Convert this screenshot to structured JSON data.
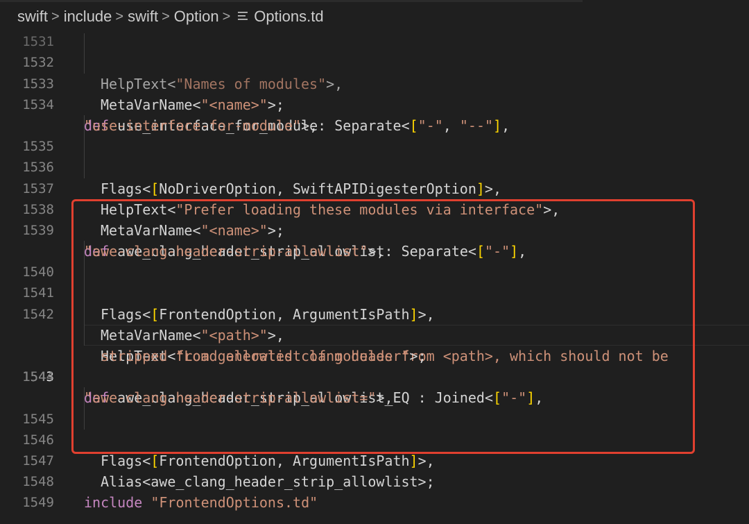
{
  "breadcrumb": {
    "items": [
      "swift",
      "include",
      "swift",
      "Option"
    ],
    "file": "Options.td",
    "separator": ">"
  },
  "code": {
    "lines": [
      {
        "num": "1531",
        "text": "HelpText<\"Names of modules\">,"
      },
      {
        "num": "1532",
        "text": "MetaVarName<\"<name>\">;"
      },
      {
        "num": "1533",
        "text": ""
      },
      {
        "num": "1534",
        "text": "def use_interface_for_module: Separate<[\"-\", \"--\"],"
      },
      {
        "num": "",
        "text": "\"use-interface-for-module\">,"
      },
      {
        "num": "1535",
        "text": "Flags<[NoDriverOption, SwiftAPIDigesterOption]>,"
      },
      {
        "num": "1536",
        "text": "HelpText<\"Prefer loading these modules via interface\">,"
      },
      {
        "num": "1537",
        "text": "MetaVarName<\"<name>\">;"
      },
      {
        "num": "1538",
        "text": ""
      },
      {
        "num": "1539",
        "text": "def awe_clang_header_strip_allowlist: Separate<[\"-\"],"
      },
      {
        "num": "",
        "text": "\"awe-clang-header-strip-allowlist\">,"
      },
      {
        "num": "1540",
        "text": "Flags<[FrontendOption, ArgumentIsPath]>,"
      },
      {
        "num": "1541",
        "text": "MetaVarName<\"<path>\">,"
      },
      {
        "num": "1542",
        "text": "HelpText<\"Load allowlist of modules from <path>, which should not be"
      },
      {
        "num": "",
        "text": "stripped from generated clang header\">;"
      },
      {
        "num": "1543",
        "text": ""
      },
      {
        "num": "1544",
        "text": "def awe_clang_header_strip_allowlist_EQ : Joined<[\"-\"],"
      },
      {
        "num": "",
        "text": "\"awe-clang-header-strip-allowlist=\">,"
      },
      {
        "num": "1545",
        "text": "Flags<[FrontendOption, ArgumentIsPath]>,"
      },
      {
        "num": "1546",
        "text": "Alias<awe_clang_header_strip_allowlist>;"
      },
      {
        "num": "1547",
        "text": ""
      },
      {
        "num": "1548",
        "text": "include \"FrontendOptions.td\""
      },
      {
        "num": "1549",
        "text": ""
      }
    ],
    "active_line": "1543"
  },
  "colors": {
    "background": "#1f1f1f",
    "keyword": "#c586c0",
    "string": "#ce9178",
    "bracket": "#ffd700",
    "text": "#d4d4d4",
    "line_number": "#858585",
    "highlight_box": "#e0402f"
  },
  "icons": {
    "file": "list-lines-icon"
  }
}
